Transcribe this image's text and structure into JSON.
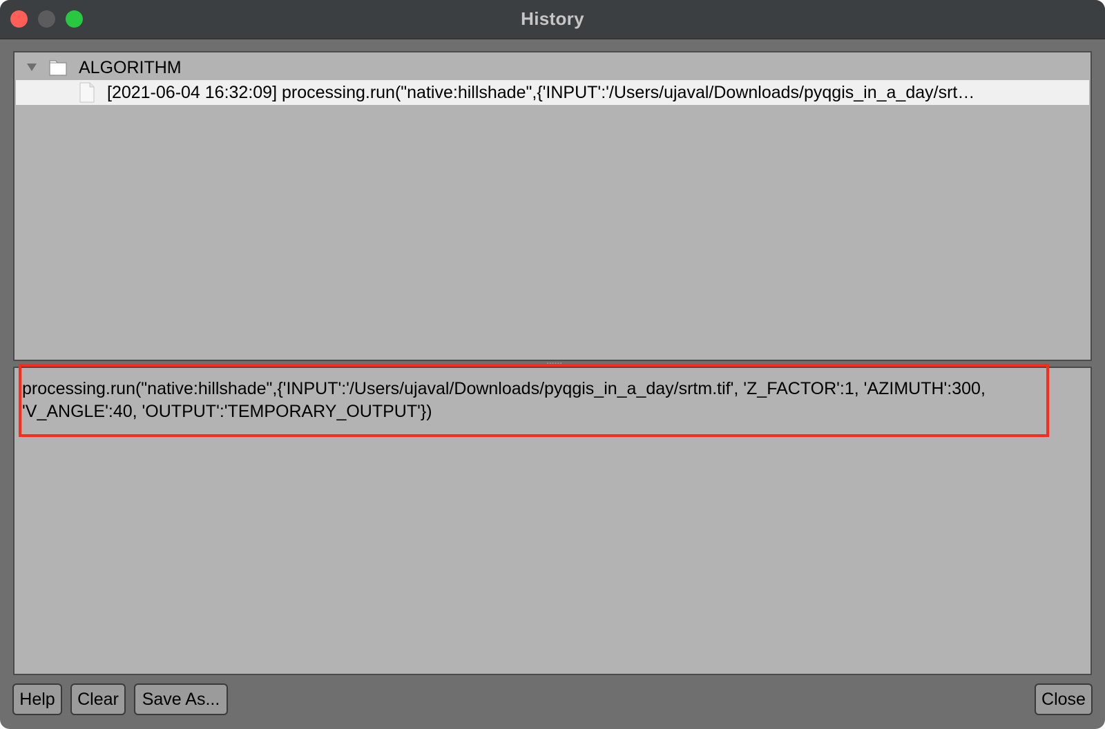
{
  "window": {
    "title": "History",
    "controls": [
      "close-button",
      "minimize-button",
      "zoom-button"
    ]
  },
  "tree": {
    "group_label": "ALGORITHM",
    "entries": [
      {
        "label": "[2021-06-04 16:32:09] processing.run(\"native:hillshade\",{'INPUT':'/Users/ujaval/Downloads/pyqgis_in_a_day/srt…"
      }
    ]
  },
  "script": {
    "text": "processing.run(\"native:hillshade\",{'INPUT':'/Users/ujaval/Downloads/pyqgis_in_a_day/srtm.tif', 'Z_FACTOR':1, 'AZIMUTH':300, 'V_ANGLE':40, 'OUTPUT':'TEMPORARY_OUTPUT'})"
  },
  "buttons": {
    "help": "Help",
    "clear": "Clear",
    "save_as": "Save As...",
    "close": "Close"
  },
  "colors": {
    "highlight": "#ff2a1a",
    "selected_row": "#f0f0f0",
    "panel": "#b3b3b3"
  }
}
